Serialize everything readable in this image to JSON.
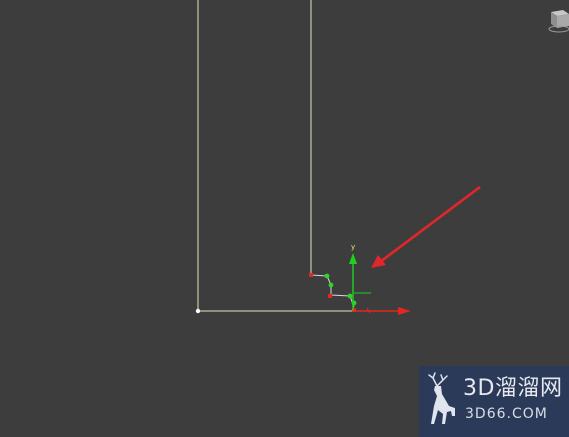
{
  "viewport": {
    "background_color": "#3d3d3d",
    "spline_color": "#e8e3b8"
  },
  "gizmo": {
    "y_axis_label": "y",
    "y_axis_color": "#1fd11f",
    "x_axis_color": "#e0281f",
    "vertex_color": "#2bd62b",
    "selected_vertex_color": "#e0281f"
  },
  "annotation": {
    "arrow_color": "#e3262a"
  },
  "viewcube": {
    "icon": "viewcube-icon"
  },
  "watermark": {
    "brand_cn": "3D溜溜网",
    "url": "3D66.COM",
    "logo_icon": "deer-logo-icon",
    "background_color": "#2b3a58"
  }
}
